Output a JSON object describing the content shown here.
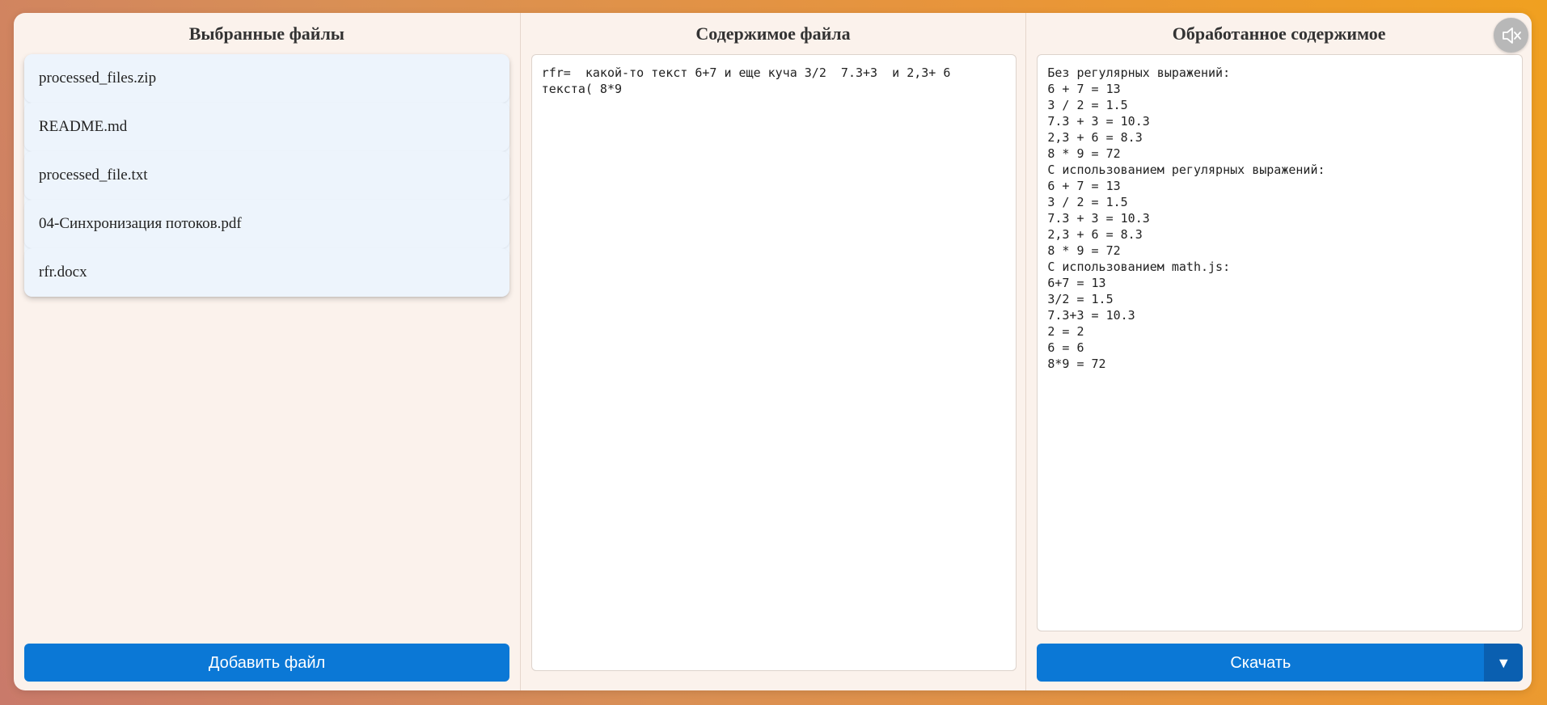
{
  "panels": {
    "files": {
      "title": "Выбранные файлы",
      "items": [
        {
          "label": "processed_files.zip"
        },
        {
          "label": "README.md"
        },
        {
          "label": "processed_file.txt"
        },
        {
          "label": "04-Синхронизация потоков.pdf"
        },
        {
          "label": "rfr.docx"
        }
      ],
      "add_button_label": "Добавить файл"
    },
    "content": {
      "title": "Содержимое файла",
      "text": "rfr=  какой-то текст 6+7 и еще куча 3/2  7.3+3  и 2,3+ 6\nтекста( 8*9"
    },
    "processed": {
      "title": "Обработанное содержимое",
      "text": "Без регулярных выражений:\n6 + 7 = 13\n3 / 2 = 1.5\n7.3 + 3 = 10.3\n2,3 + 6 = 8.3\n8 * 9 = 72\nС использованием регулярных выражений:\n6 + 7 = 13\n3 / 2 = 1.5\n7.3 + 3 = 10.3\n2,3 + 6 = 8.3\n8 * 9 = 72\nС использованием math.js:\n6+7 = 13\n3/2 = 1.5\n7.3+3 = 10.3\n2 = 2\n6 = 6\n8*9 = 72",
      "download_button_label": "Скачать",
      "dropdown_glyph": "▼"
    }
  },
  "mute_button": {
    "icon": "speaker-muted-icon"
  },
  "colors": {
    "accent": "#0b78d6",
    "accent_dark": "#0a5fb0",
    "panel_bg": "#fbf2ec",
    "list_item_bg": "#edf4fc"
  }
}
